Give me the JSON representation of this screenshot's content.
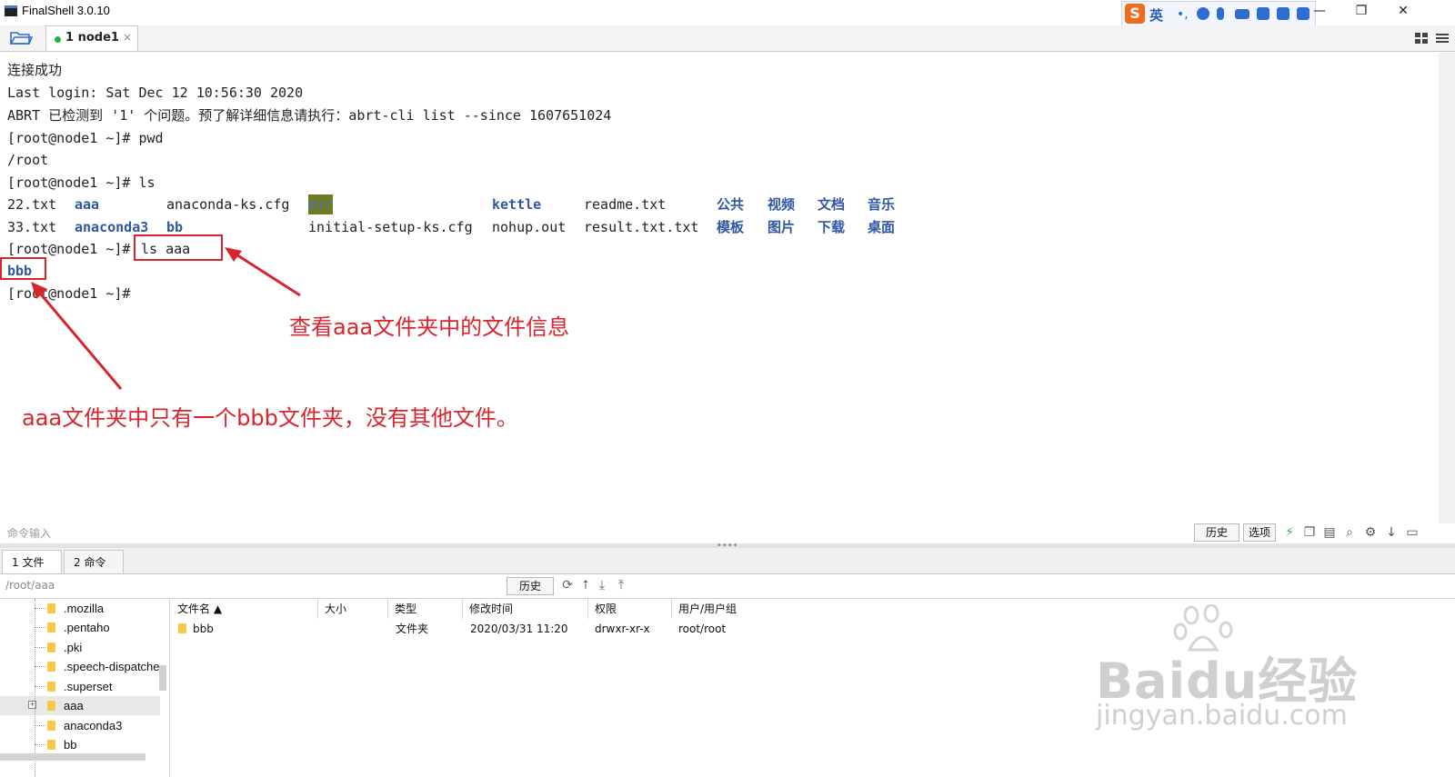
{
  "window": {
    "title": "FinalShell 3.0.10",
    "minimize": "—",
    "maximize": "❐",
    "close": "✕"
  },
  "ime": {
    "logo": "S",
    "lang": "英"
  },
  "session_tab": {
    "label": "1 node1",
    "close": "×"
  },
  "terminal": {
    "lines": [
      "连接成功",
      "Last login: Sat Dec 12 10:56:30 2020",
      "ABRT 已检测到 '1' 个问题。预了解详细信息请执行：abrt-cli list --since 1607651024",
      "[root@node1 ~]# pwd",
      "/root",
      "[root@node1 ~]# ls"
    ],
    "ls_row1": [
      "22.txt",
      "aaa",
      "anaconda-ks.cfg",
      "dir",
      "kettle",
      "readme.txt",
      "公共",
      "视频",
      "文档",
      "音乐"
    ],
    "ls_row2": [
      "33.txt",
      "anaconda3",
      "bb",
      "initial-setup-ks.cfg",
      "nohup.out",
      "result.txt.txt",
      "模板",
      "图片",
      "下载",
      "桌面"
    ],
    "prompt": "[root@node1 ~]# ",
    "cmd": "ls aaa",
    "output": "bbb",
    "final_prompt": "[root@node1 ~]#"
  },
  "annotations": {
    "right": "查看aaa文件夹中的文件信息",
    "left": "aaa文件夹中只有一个bbb文件夹，没有其他文件。"
  },
  "command_bar": {
    "placeholder": "命令输入",
    "history": "历史",
    "options": "选项"
  },
  "bottom_tabs": [
    "1 文件",
    "2 命令"
  ],
  "file_browser": {
    "path": "/root/aaa",
    "history": "历史",
    "tree": [
      ".mozilla",
      ".pentaho",
      ".pki",
      ".speech-dispatche",
      ".superset",
      "aaa",
      "anaconda3",
      "bb"
    ],
    "headers": [
      "文件名 ▲",
      "大小",
      "类型",
      "修改时间",
      "权限",
      "用户/用户组"
    ],
    "rows": [
      {
        "name": "bbb",
        "size": "",
        "type": "文件夹",
        "modified": "2020/03/31 11:20",
        "perm": "drwxr-xr-x",
        "owner": "root/root"
      }
    ]
  },
  "watermark": {
    "brand": "Baidu经验",
    "url": "jingyan.baidu.com"
  },
  "colors": {
    "annotation": "#d9242b",
    "dir": "#2f57a4",
    "ok_dot": "#19b64a"
  }
}
